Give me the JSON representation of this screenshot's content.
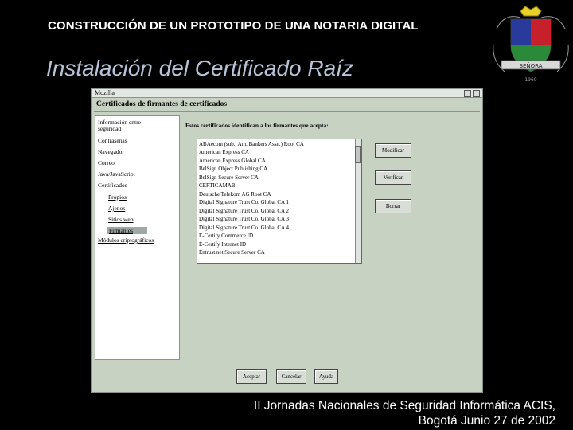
{
  "slide": {
    "header": "CONSTRUCCIÓN DE UN PROTOTIPO DE UNA NOTARIA DIGITAL",
    "title": "Instalación del Certificado Raíz",
    "footer_line1": "II Jornadas Nacionales de Seguridad Informática ACIS,",
    "footer_line2": "Bogotá Junio 27 de 2002"
  },
  "logo": {
    "banner": "SEÑORA",
    "year": "1960",
    "icon": "university-crest-icon",
    "colors": {
      "yellow": "#e8d22a",
      "red": "#c8202a",
      "green": "#2a8a3a",
      "blue": "#2a3a9a"
    }
  },
  "window": {
    "title": "Mozilla",
    "heading": "Certificados de firmantes de certificados",
    "nav": {
      "items": [
        "Información entre seguridad",
        "Contraseñas",
        "Navegador",
        "Correo",
        "Java/JavaScript",
        "Certificados"
      ],
      "subitems": [
        "Propios",
        "Ajenos",
        "Sitios web",
        "Firmantes"
      ],
      "last": "Módulos criptográficos",
      "selected": "Firmantes"
    },
    "prompt": "Estos certificados identifican a los firmantes que acepta:",
    "certificates": [
      "ABAecom (sub., Am. Bankers Assn.) Root CA",
      "American Express CA",
      "American Express Global CA",
      "BelSign Object Publishing CA",
      "BelSign Secure Server CA",
      "CERTICAMAB",
      "Deutsche Telekom AG Root CA",
      "Digital Signature Trust Co. Global CA 1",
      "Digital Signature Trust Co. Global CA 2",
      "Digital Signature Trust Co. Global CA 3",
      "Digital Signature Trust Co. Global CA 4",
      "E-Certify Commerce ID",
      "E-Certify Internet ID",
      "Entrust.net Secure Server CA"
    ],
    "buttons": {
      "edit": "Modificar",
      "verify": "Verificar",
      "delete": "Borrar",
      "ok": "Aceptar",
      "cancel": "Cancelar",
      "help": "Ayuda"
    }
  }
}
